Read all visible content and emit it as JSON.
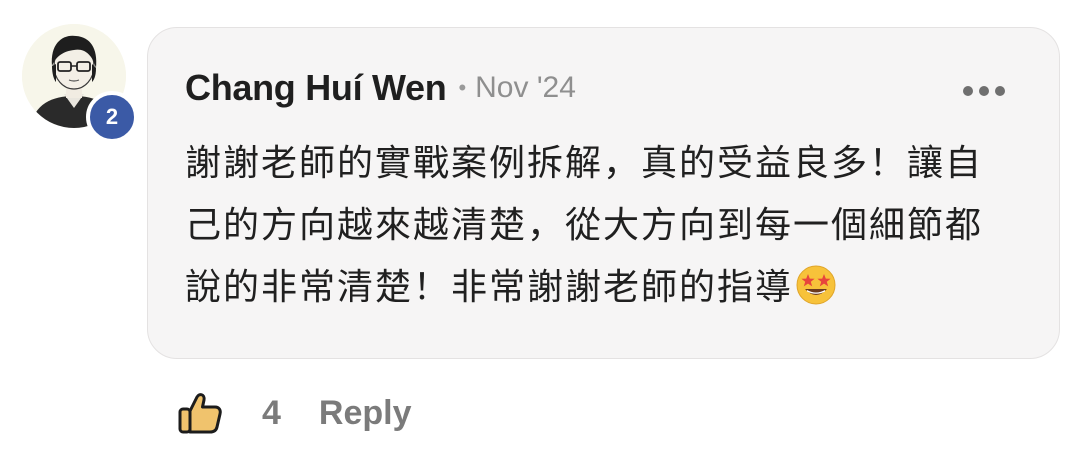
{
  "author": {
    "name": "Chang Huí Wen",
    "avatar_icon": "illustrated-avatar-with-glasses",
    "level_badge": "2",
    "badge_color": "#3b5aa6"
  },
  "header": {
    "separator": "•",
    "timestamp": "Nov '24",
    "menu_icon": "more-horizontal-icon"
  },
  "comment": {
    "lines": [
      "謝謝老師的實戰案例拆解，真的受益良多！讓自",
      "己的方向越來越清楚，從大方向到每一個細節都",
      "說的非常清楚！非常謝謝老師的指導"
    ],
    "emoji": "star-struck-emoji"
  },
  "actions": {
    "like_icon": "thumbs-up-icon",
    "like_count": "4",
    "reply_label": "Reply"
  },
  "colors": {
    "bubble_background": "#f6f5f5",
    "text": "#202020",
    "muted_text": "#7b7b7b",
    "like_icon_fill": "#f0c36d"
  }
}
